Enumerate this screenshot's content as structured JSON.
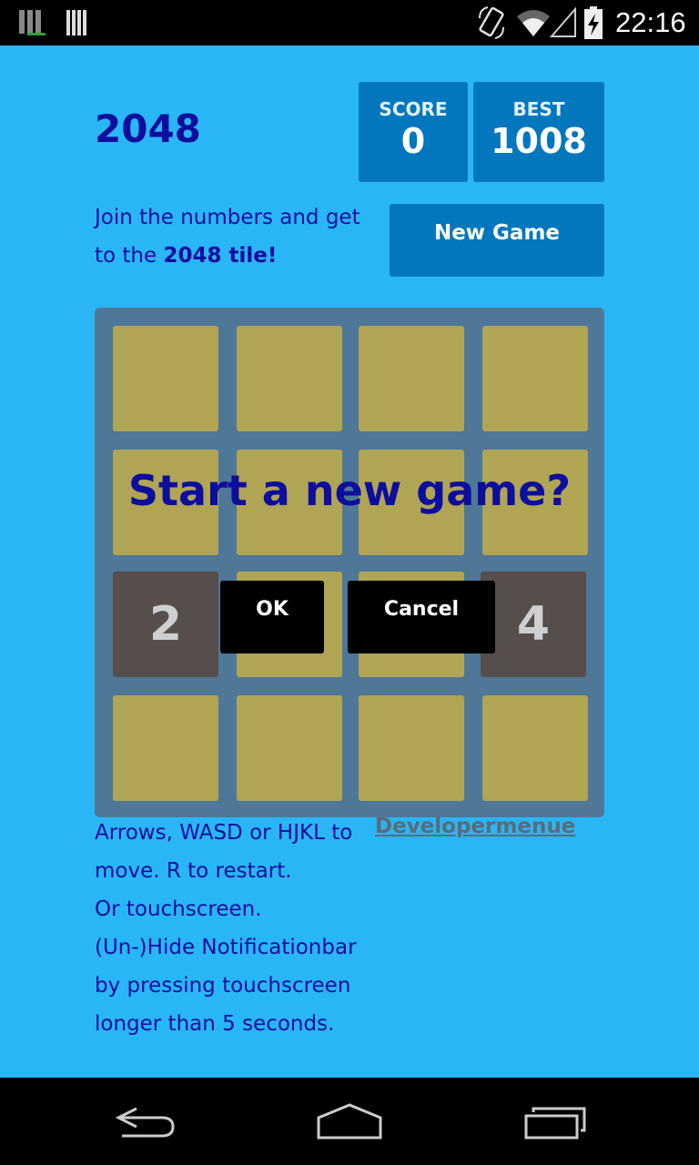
{
  "status_bar": {
    "time": "22:16",
    "icons": [
      "notification-app-icon",
      "notification-app-icon-2",
      "screen-rotation-icon",
      "wifi-icon",
      "signal-icon",
      "battery-charging-icon"
    ]
  },
  "header": {
    "title": "2048",
    "score_label": "SCORE",
    "score_value": "0",
    "best_label": "BEST",
    "best_value": "1008"
  },
  "intro": {
    "text_before": "Join the numbers and get to the ",
    "text_bold": "2048 tile!"
  },
  "new_game_label": "New Game",
  "board": {
    "rows": [
      [
        "",
        "",
        "",
        ""
      ],
      [
        "",
        "",
        "",
        ""
      ],
      [
        "2",
        "",
        "",
        "4"
      ],
      [
        "",
        "",
        "",
        ""
      ]
    ],
    "colors": {
      "background": "#4f7797",
      "empty_cell": "#b0a455",
      "tile": "#554e4a"
    }
  },
  "dialog": {
    "message": "Start a new game?",
    "ok_label": "OK",
    "cancel_label": "Cancel"
  },
  "instructions": [
    "Arrows, WASD or HJKL to",
    "move. R to restart.",
    "Or touchscreen.",
    "(Un-)Hide Notificationbar",
    "by pressing touchscreen",
    "longer than 5 seconds."
  ],
  "developer_menu_label": "Developermenue",
  "nav_bar": {
    "icons": [
      "back-icon",
      "home-icon",
      "recent-apps-icon"
    ]
  },
  "colors": {
    "page_background": "#29b6f6",
    "accent": "#0277bd",
    "title_text": "#0d0d9e"
  }
}
